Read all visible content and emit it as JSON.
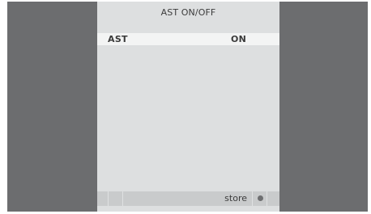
{
  "screen": {
    "title": "AST ON/OFF"
  },
  "menu": {
    "items": [
      {
        "label": "AST",
        "value": "ON",
        "selected": true
      }
    ]
  },
  "footer": {
    "store_label": "store",
    "indicator_icon": "dot-icon"
  },
  "colors": {
    "side_background": "#6c6d6f",
    "panel_background": "#dddfe0",
    "highlight_row": "#f3f4f4",
    "footer_bar": "#c9cbcc",
    "text": "#3a3a3a"
  }
}
